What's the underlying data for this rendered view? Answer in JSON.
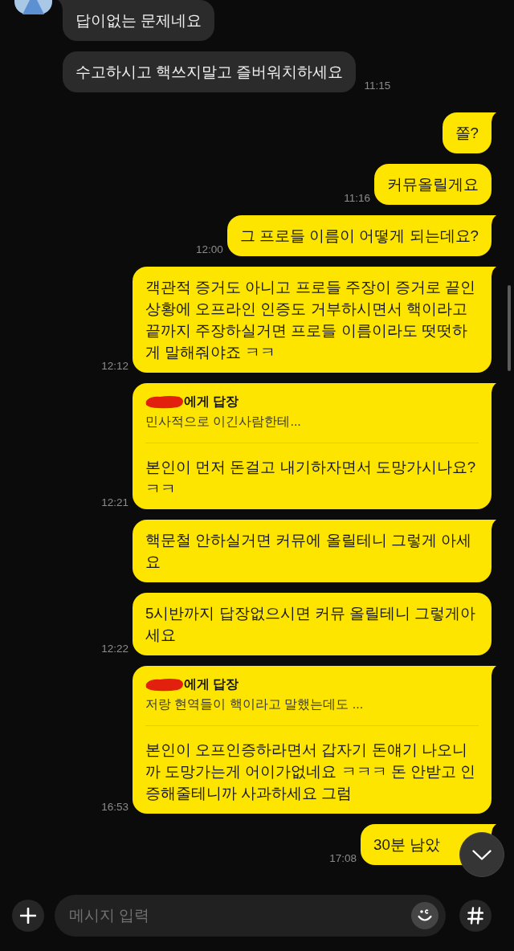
{
  "messages": [
    {
      "kind": "received",
      "text": "답이없는 문제네요",
      "tail": true
    },
    {
      "kind": "received",
      "text": "수고하시고 핵쓰지말고 즐버워치하세요",
      "tail": false,
      "time": "11:15"
    },
    {
      "kind": "sent",
      "text": "쫄?",
      "tail": true
    },
    {
      "kind": "sent",
      "text": "커뮤올릴게요",
      "tail": false,
      "time": "11:16"
    },
    {
      "kind": "sent",
      "text": "그 프로들 이름이 어떻게 되는데요?",
      "tail": true,
      "time": "12:00"
    },
    {
      "kind": "sent",
      "text": "객관적 증거도 아니고 프로들 주장이 증거로 끝인 상황에 오프라인 인증도 거부하시면서 핵이라고 끝까지 주장하실거면 프로들 이름이라도 떳떳하게 말해줘야죠 ㅋㅋ",
      "tail": true,
      "time": "12:12"
    },
    {
      "kind": "sent",
      "reply": {
        "redacted": true,
        "label": "에게 답장",
        "quote": "민사적으로 이긴사람한테..."
      },
      "text": "본인이 먼저 돈걸고 내기하자면서 도망가시나요? ㅋㅋ",
      "tail": true,
      "time": "12:21"
    },
    {
      "kind": "sent",
      "text": "핵문철 안하실거면 커뮤에 올릴테니 그렇게 아세요",
      "tail": true
    },
    {
      "kind": "sent",
      "text": "5시반까지 답장없으시면 커뮤 올릴테니 그렇게아세요",
      "tail": false,
      "time": "12:22"
    },
    {
      "kind": "sent",
      "reply": {
        "redacted": true,
        "label": "에게 답장",
        "quote": "저랑 현역들이 핵이라고 말했는데도 ..."
      },
      "text": "본인이 오프인증하라면서 갑자기 돈얘기 나오니까 도망가는게 어이가없네요 ㅋㅋㅋ 돈 안받고 인증해줄테니까 사과하세요 그럼",
      "tail": true,
      "time": "16:53"
    },
    {
      "kind": "sent",
      "text": "30분 남았",
      "tail": true,
      "time": "17:08"
    }
  ],
  "composer": {
    "placeholder": "메시지 입력"
  }
}
